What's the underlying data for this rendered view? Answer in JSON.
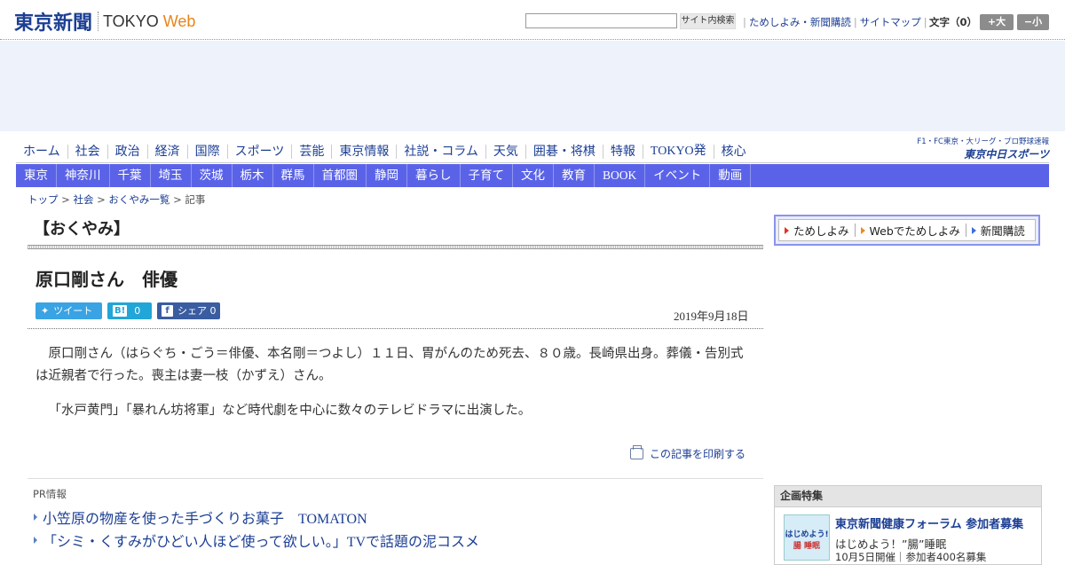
{
  "header": {
    "logo_ja": "東京新聞",
    "logo_tokyo": "TOKYO",
    "logo_web": "Web",
    "search_placeholder": "",
    "search_button": "サイト内検索",
    "links": [
      "ためしよみ・新聞購読",
      "サイトマップ"
    ],
    "font_size_label": "文字（0）",
    "font_larger": "+大",
    "font_smaller": "−小"
  },
  "nav_primary": [
    "ホーム",
    "社会",
    "政治",
    "経済",
    "国際",
    "スポーツ",
    "芸能",
    "東京情報",
    "社説・コラム",
    "天気",
    "囲碁・将棋",
    "特報",
    "TOKYO発",
    "核心"
  ],
  "chunichi": {
    "line1": "F1・FC東京・大リーグ・プロ野球速報",
    "line2": "東京中日スポーツ"
  },
  "nav_regions": [
    "東京",
    "神奈川",
    "千葉",
    "埼玉",
    "茨城",
    "栃木",
    "群馬",
    "首都圏",
    "静岡",
    "暮らし",
    "子育て",
    "文化",
    "教育",
    "BOOK",
    "イベント",
    "動画"
  ],
  "breadcrumb": {
    "top": "トップ",
    "social": "社会",
    "obituary_list": "おくやみ一覧",
    "current": "記事",
    "sep": ">"
  },
  "section_title": "【おくやみ】",
  "article": {
    "title": "原口剛さん　俳優",
    "date": "2019年9月18日",
    "share": {
      "tweet": "ツイート",
      "hatena_count": "0",
      "fb_label": "シェア",
      "fb_count": "0"
    },
    "paragraphs": [
      "原口剛さん（はらぐち・ごう＝俳優、本名剛＝つよし）１１日、胃がんのため死去、８０歳。長崎県出身。葬儀・告別式は近親者で行った。喪主は妻一枝（かずえ）さん。",
      "「水戸黄門」「暴れん坊将軍」など時代劇を中心に数々のテレビドラマに出演した。"
    ],
    "print_link": "この記事を印刷する"
  },
  "pr": {
    "label": "PR情報",
    "items": [
      "小笠原の物産を使った手づくりお菓子　TOMATON",
      "「シミ・くすみがひどい人ほど使って欲しい。」TVで話題の泥コスメ"
    ]
  },
  "subscribe": {
    "items": [
      "ためしよみ",
      "Webでためしよみ",
      "新聞購読"
    ],
    "colors": [
      "#e0322a",
      "#f08a1c",
      "#3a6fd8"
    ]
  },
  "feature": {
    "header": "企画特集",
    "title": "東京新聞健康フォーラム 参加者募集",
    "subtitle": "はじめよう！”腸”睡眠",
    "date": "10月5日開催｜参加者400名募集",
    "thumb_line1": "はじめよう!",
    "thumb_line2": "腸 睡眠"
  },
  "colors": {
    "brand": "#1c3f94",
    "nav_band": "#5a63e8",
    "accent_orange": "#e8841a"
  }
}
